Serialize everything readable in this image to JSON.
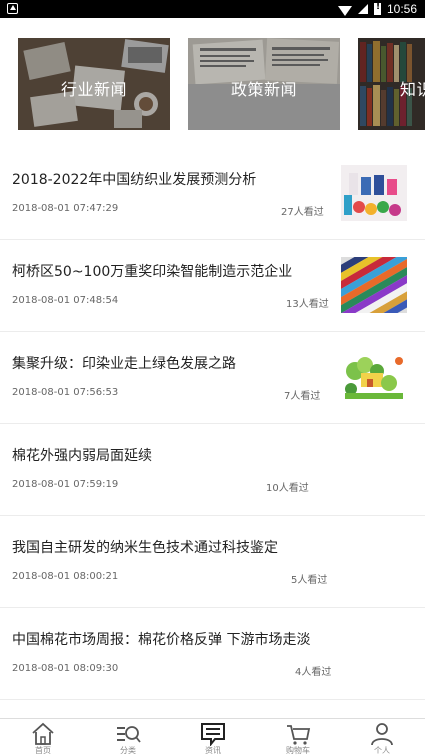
{
  "status_bar": {
    "time": "10:56"
  },
  "categories": [
    {
      "label": "行业新闻"
    },
    {
      "label": "政策新闻"
    },
    {
      "label": "知识"
    }
  ],
  "news": [
    {
      "title": "2018-2022年中国纺织业发展预测分析",
      "date": "2018-08-01 07:47:29",
      "views": "27人看过",
      "thumb": "color-spools-thumb"
    },
    {
      "title": "柯桥区50~100万重奖印染智能制造示范企业",
      "date": "2018-08-01 07:48:54",
      "views": "13人看过",
      "thumb": "fabric-stripes-thumb"
    },
    {
      "title": "集聚升级：印染业走上绿色发展之路",
      "date": "2018-08-01 07:56:53",
      "views": "7人看过",
      "thumb": "green-illustration-thumb"
    },
    {
      "title": "棉花外强内弱局面延续",
      "date": "2018-08-01 07:59:19",
      "views": "10人看过"
    },
    {
      "title": "我国自主研发的纳米生色技术通过科技鉴定",
      "date": "2018-08-01 08:00:21",
      "views": "5人看过"
    },
    {
      "title": "中国棉花市场周报：棉花价格反弹 下游市场走淡",
      "date": "2018-08-01 08:09:30",
      "views": "4人看过"
    }
  ],
  "tabbar": [
    {
      "label": "首页",
      "icon": "home-icon"
    },
    {
      "label": "分类",
      "icon": "category-search-icon"
    },
    {
      "label": "资讯",
      "icon": "news-chat-icon"
    },
    {
      "label": "购物车",
      "icon": "cart-icon"
    },
    {
      "label": "个人",
      "icon": "user-icon"
    }
  ],
  "colors": {
    "accent": "#222222",
    "text": "#222222",
    "muted": "#666666"
  }
}
